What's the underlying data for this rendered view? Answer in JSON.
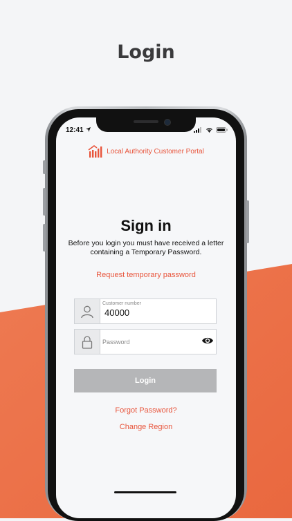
{
  "page_heading": "Login",
  "status_bar": {
    "time": "12:41"
  },
  "brand": {
    "name": "Local Authority Customer Portal"
  },
  "signin": {
    "title": "Sign in",
    "subtitle": "Before you login you must have received a letter containing a Temporary Password.",
    "request_link": "Request temporary password"
  },
  "form": {
    "customer_number": {
      "label": "Customer number",
      "value": "40000"
    },
    "password": {
      "placeholder": "Password"
    },
    "login_label": "Login"
  },
  "links": {
    "forgot_password": "Forgot Password?",
    "change_region": "Change Region"
  },
  "colors": {
    "accent": "#e8543b",
    "orange_bg": "#ef7b4f",
    "button_disabled": "#b5b6b8"
  },
  "icons": [
    "location-arrow-icon",
    "signal-icon",
    "wifi-icon",
    "battery-icon",
    "brand-logo-icon",
    "user-icon",
    "lock-icon",
    "eye-icon"
  ]
}
